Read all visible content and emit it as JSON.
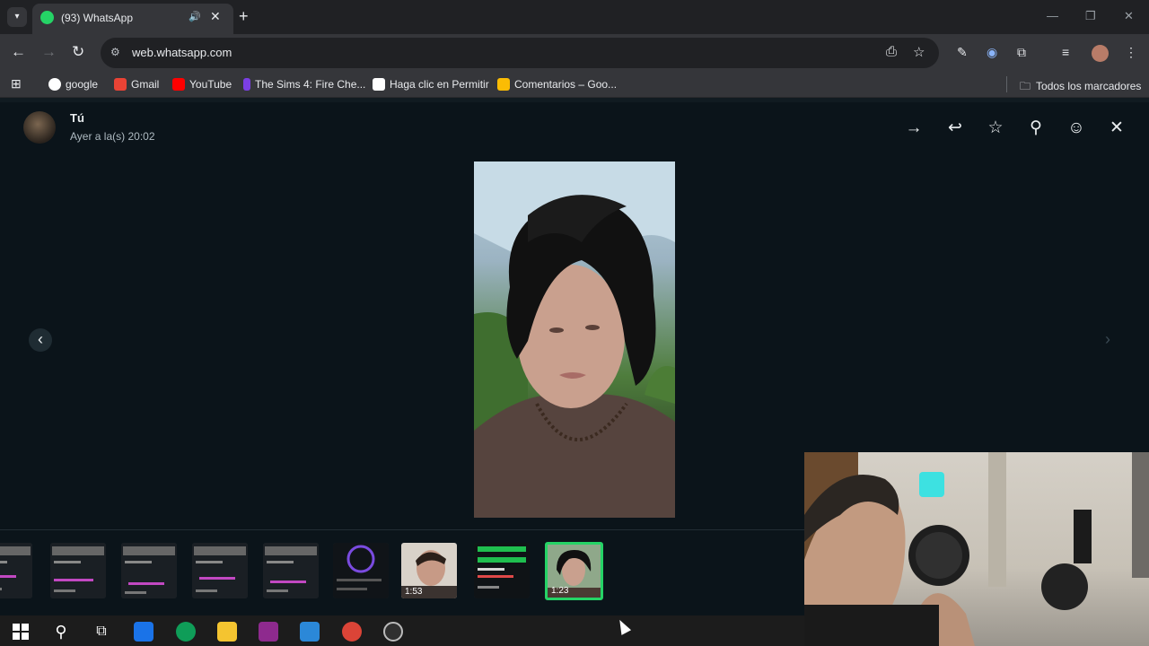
{
  "browser": {
    "tab_title": "(93) WhatsApp",
    "new_tab": "+",
    "url": "web.whatsapp.com",
    "bookmarks": [
      {
        "label": "google",
        "color": "#ffffff"
      },
      {
        "label": "Gmail",
        "color": "#ea4335"
      },
      {
        "label": "YouTube",
        "color": "#ff0000"
      },
      {
        "label": "The Sims 4: Fire Che...",
        "color": "#7b3fe4"
      },
      {
        "label": "Haga clic en Permitir",
        "color": "#ffffff"
      },
      {
        "label": "Comentarios – Goo...",
        "color": "#fbbc04"
      }
    ],
    "all_bookmarks": "Todos los marcadores"
  },
  "viewer": {
    "sender_name": "Tú",
    "sender_time": "Ayer a la(s) 20:02",
    "actions": [
      {
        "name": "forward-icon",
        "glyph": "→"
      },
      {
        "name": "reply-icon",
        "glyph": "↩"
      },
      {
        "name": "star-icon",
        "glyph": "☆"
      },
      {
        "name": "pin-icon",
        "glyph": "⚲"
      },
      {
        "name": "emoji-icon",
        "glyph": "☺"
      },
      {
        "name": "close-icon",
        "glyph": "✕"
      }
    ],
    "prev_glyph": "‹",
    "next_glyph": "›",
    "thumbnails": [
      {
        "type": "screenshot",
        "duration": ""
      },
      {
        "type": "screenshot",
        "duration": ""
      },
      {
        "type": "screenshot",
        "duration": ""
      },
      {
        "type": "screenshot",
        "duration": ""
      },
      {
        "type": "screenshot",
        "duration": ""
      },
      {
        "type": "timer",
        "duration": ""
      },
      {
        "type": "video",
        "duration": "1:53"
      },
      {
        "type": "screenshot-green",
        "duration": ""
      },
      {
        "type": "video",
        "duration": "1:23",
        "selected": true
      }
    ]
  },
  "taskbar": {
    "icons": [
      "windows-start-icon",
      "search-icon",
      "task-view-icon",
      "outlook-icon",
      "edge-icon",
      "file-explorer-icon",
      "winrar-icon",
      "store-icon",
      "chrome-icon",
      "obs-icon"
    ]
  }
}
